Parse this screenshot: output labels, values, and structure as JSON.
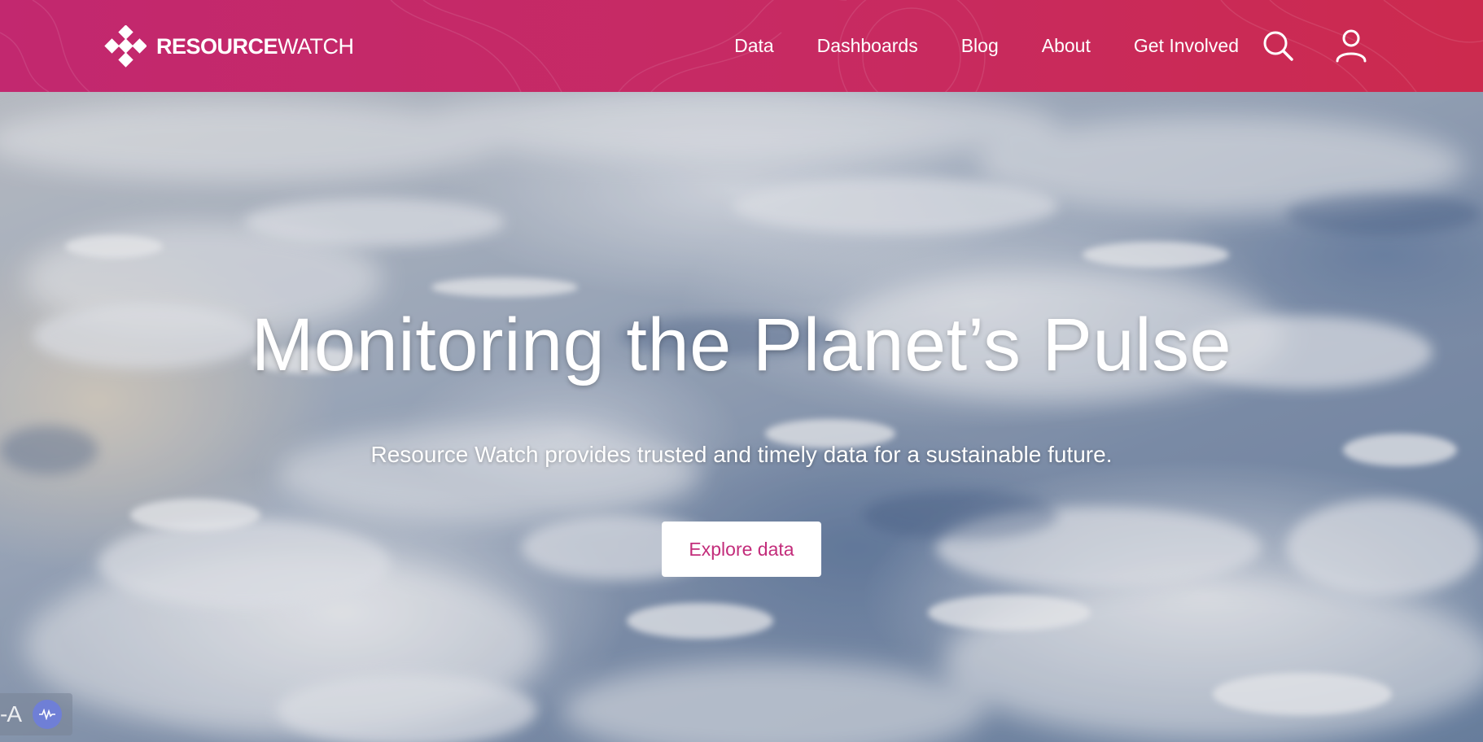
{
  "header": {
    "logo": {
      "bold": "RESOURCE",
      "light": "WATCH",
      "icon": "resource-watch-logo-mark"
    },
    "nav": [
      {
        "label": "Data"
      },
      {
        "label": "Dashboards"
      },
      {
        "label": "Blog"
      },
      {
        "label": "About"
      },
      {
        "label": "Get Involved"
      }
    ],
    "icons": {
      "search": "search-icon",
      "user": "user-icon"
    },
    "color": "#c72a62"
  },
  "hero": {
    "title": "Monitoring the Planet’s Pulse",
    "subtitle": "Resource Watch provides trusted and timely data for a sustainable future.",
    "cta_label": "Explore data",
    "cta_color": "#c32d7b"
  },
  "widget": {
    "text": "-A",
    "icon": "audio-wave-icon"
  }
}
